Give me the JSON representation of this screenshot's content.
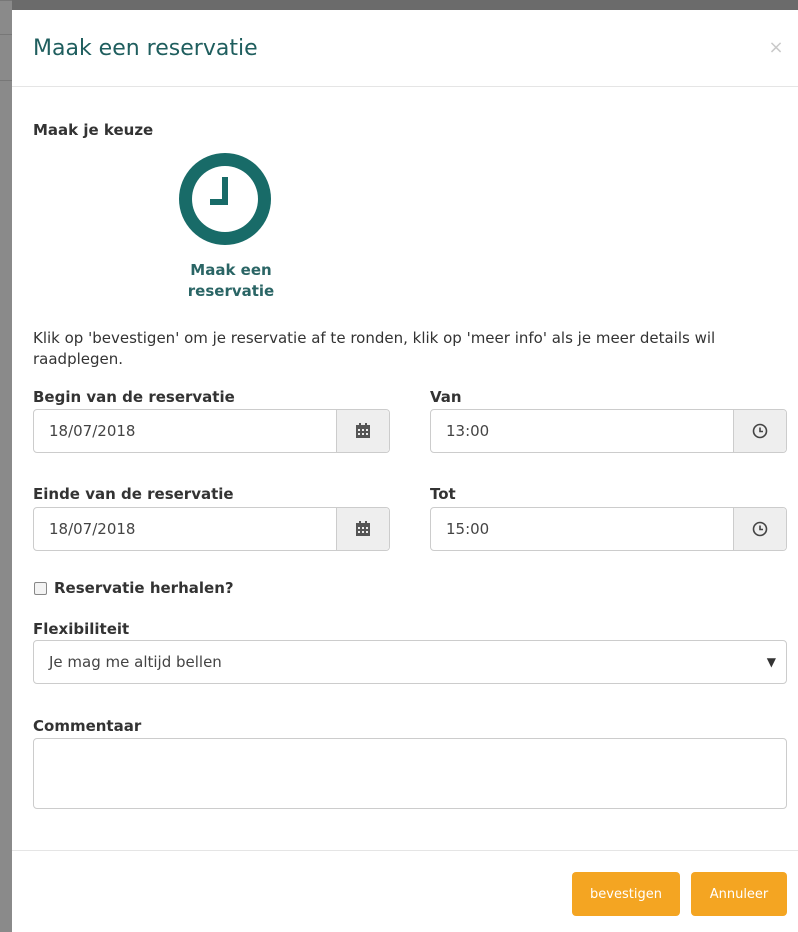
{
  "modal": {
    "title": "Maak een reservatie",
    "close_label": "×"
  },
  "choice": {
    "heading": "Maak je keuze",
    "option_label_line1": "Maak een",
    "option_label_line2": "reservatie",
    "icon": "clock-icon",
    "accent_color": "#186b68"
  },
  "intro_text": "Klik op 'bevestigen' om je reservatie af te ronden, klik op 'meer info' als je meer details wil raadplegen.",
  "start": {
    "date_label": "Begin van de reservatie",
    "date_value": "18/07/2018",
    "time_label": "Van",
    "time_value": "13:00"
  },
  "end": {
    "date_label": "Einde van de reservatie",
    "date_value": "18/07/2018",
    "time_label": "Tot",
    "time_value": "15:00"
  },
  "repeat": {
    "label": "Reservatie herhalen?",
    "checked": false
  },
  "flexibility": {
    "label": "Flexibiliteit",
    "selected": "Je mag me altijd bellen"
  },
  "comment": {
    "label": "Commentaar",
    "value": ""
  },
  "footer": {
    "confirm_label": "bevestigen",
    "cancel_label": "Annuleer",
    "button_color": "#f4a522"
  }
}
